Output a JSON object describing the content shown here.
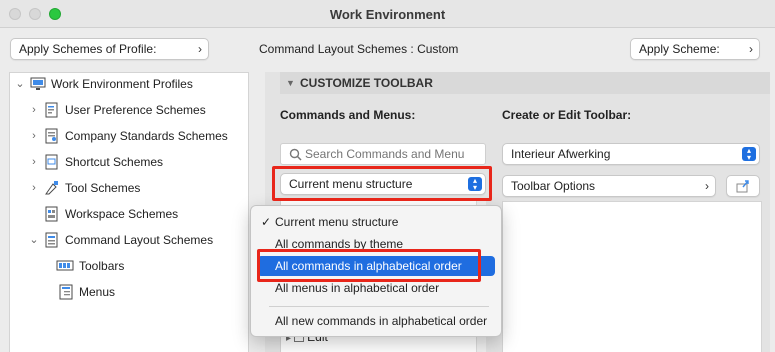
{
  "window": {
    "title": "Work Environment"
  },
  "toolbar": {
    "apply_profile_label": "Apply Schemes of Profile:",
    "layout_schemes_label": "Command Layout Schemes : Custom",
    "apply_scheme_label": "Apply Scheme:"
  },
  "tree": {
    "root": "Work Environment Profiles",
    "items": [
      {
        "label": "User Preference Schemes"
      },
      {
        "label": "Company Standards Schemes"
      },
      {
        "label": "Shortcut Schemes"
      },
      {
        "label": "Tool Schemes"
      },
      {
        "label": "Workspace Schemes"
      },
      {
        "label": "Command Layout Schemes"
      },
      {
        "label": "Toolbars"
      },
      {
        "label": "Menus"
      }
    ]
  },
  "customize": {
    "section_title": "CUSTOMIZE TOOLBAR",
    "commands_label": "Commands and Menus:",
    "create_label": "Create or Edit Toolbar:",
    "search_placeholder": "Search Commands and Menu",
    "structure_value": "Current menu structure",
    "toolbar_value": "Interieur Afwerking",
    "toolbar_options_label": "Toolbar Options",
    "partial_list_item": "Edit"
  },
  "dropdown": {
    "options": [
      "Current menu structure",
      "All commands by theme",
      "All commands in alphabetical order",
      "All menus in alphabetical order",
      "All new commands in alphabetical order"
    ],
    "checked_index": 0,
    "highlighted_index": 2
  },
  "colors": {
    "accent": "#1f6de0",
    "highlight_box": "#e8261a"
  }
}
